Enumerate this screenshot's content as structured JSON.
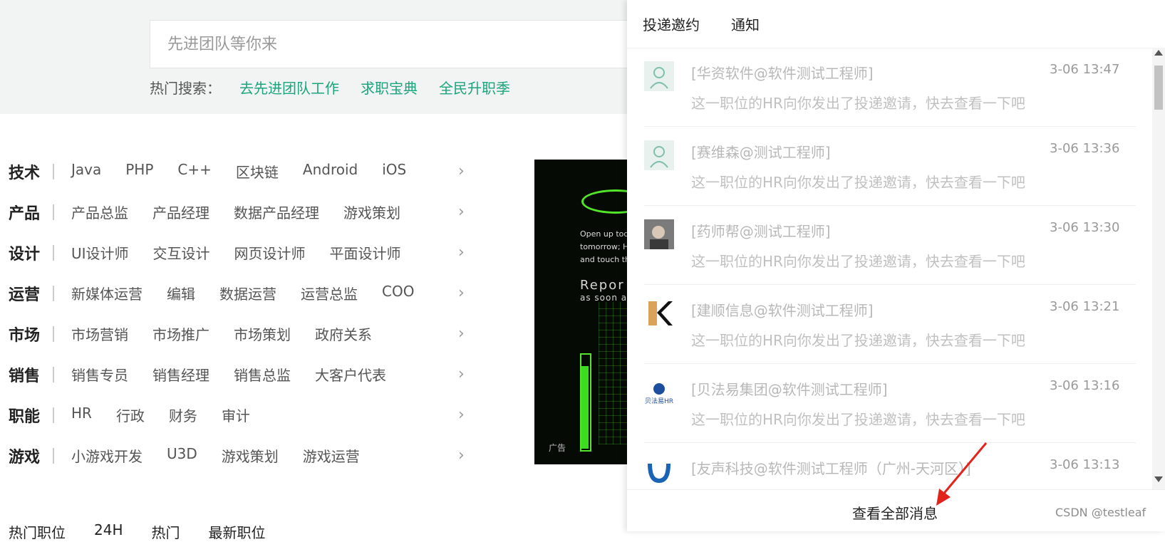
{
  "search": {
    "placeholder": "先进团队等你来"
  },
  "hot_search": {
    "label": "热门搜索：",
    "links": [
      "去先进团队工作",
      "求职宝典",
      "全民升职季"
    ]
  },
  "categories": [
    {
      "name": "技术",
      "items": [
        "Java",
        "PHP",
        "C++",
        "区块链",
        "Android",
        "iOS"
      ]
    },
    {
      "name": "产品",
      "items": [
        "产品总监",
        "产品经理",
        "数据产品经理",
        "游戏策划"
      ]
    },
    {
      "name": "设计",
      "items": [
        "UI设计师",
        "交互设计",
        "网页设计师",
        "平面设计师"
      ]
    },
    {
      "name": "运营",
      "items": [
        "新媒体运营",
        "编辑",
        "数据运营",
        "运营总监",
        "COO"
      ]
    },
    {
      "name": "市场",
      "items": [
        "市场营销",
        "市场推广",
        "市场策划",
        "政府关系"
      ]
    },
    {
      "name": "销售",
      "items": [
        "销售专员",
        "销售经理",
        "销售总监",
        "大客户代表"
      ]
    },
    {
      "name": "职能",
      "items": [
        "HR",
        "行政",
        "财务",
        "审计"
      ]
    },
    {
      "name": "游戏",
      "items": [
        "小游戏开发",
        "U3D",
        "游戏策划",
        "游戏运营"
      ]
    }
  ],
  "ad": {
    "text_lines": [
      "Open up tod",
      "tomorrow; H",
      "and touch th"
    ],
    "big_text": "Repor",
    "sub_text": "as soon a",
    "tag": "广告"
  },
  "panel": {
    "tabs": [
      "投递邀约",
      "通知"
    ],
    "messages": [
      {
        "title": "[华资软件@软件测试工程师]",
        "time": "3-06 13:47",
        "desc": "这一职位的HR向你发出了投递邀请，快去查看一下吧",
        "avatar": "person-icon"
      },
      {
        "title": "[赛维森@测试工程师]",
        "time": "3-06 13:36",
        "desc": "这一职位的HR向你发出了投递邀请，快去查看一下吧",
        "avatar": "person-icon"
      },
      {
        "title": "[药师帮@测试工程师]",
        "time": "3-06 13:30",
        "desc": "这一职位的HR向你发出了投递邀请，快去查看一下吧",
        "avatar": "photo"
      },
      {
        "title": "[建顺信息@软件测试工程师]",
        "time": "3-06 13:21",
        "desc": "这一职位的HR向你发出了投递邀请，快去查看一下吧",
        "avatar": "logo-k"
      },
      {
        "title": "[贝法易集团@软件测试工程师]",
        "time": "3-06 13:16",
        "desc": "这一职位的HR向你发出了投递邀请，快去查看一下吧",
        "avatar": "logo-hr"
      },
      {
        "title": "[友声科技@软件测试工程师（广州-天河区）]",
        "time": "3-06 13:13",
        "desc": "",
        "avatar": "logo-u"
      }
    ],
    "view_all": "查看全部消息",
    "watermark": "CSDN @testleaf"
  },
  "bottom_tabs": [
    "热门职位",
    "24H",
    "热门",
    "最新职位"
  ]
}
